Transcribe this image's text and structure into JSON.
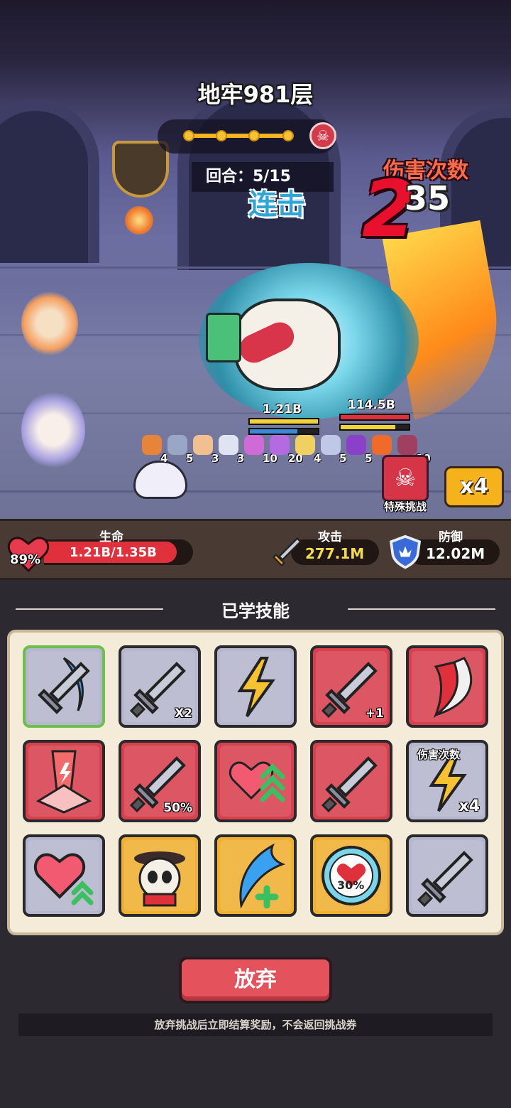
{
  "battle": {
    "title": "地牢981层",
    "round_label": "回合：5/15",
    "damage_count_label": "伤害次数",
    "big_hit": "2",
    "hit_count": "35",
    "combo_label": "连击",
    "enemy_hp_left": "1.21B",
    "enemy_hp_right": "114.5B",
    "progress_stage": 5,
    "progress_total": 5
  },
  "buffs": [
    {
      "icon": "fox-icon",
      "count": "4",
      "color": "#e8843a"
    },
    {
      "icon": "sword-icon",
      "count": "5",
      "color": "#9aa6c6"
    },
    {
      "icon": "cat-icon",
      "count": "3",
      "color": "#f2c090"
    },
    {
      "icon": "ghost-icon",
      "count": "3",
      "color": "#e0e4f2"
    },
    {
      "icon": "mushroom-icon",
      "count": "10",
      "color": "#d06ad6"
    },
    {
      "icon": "crystal-icon",
      "count": "20",
      "color": "#b46ae0"
    },
    {
      "icon": "staff-icon",
      "count": "4",
      "color": "#f0d060"
    },
    {
      "icon": "angel-icon",
      "count": "5",
      "color": "#c0c8e8"
    },
    {
      "icon": "skull-icon",
      "count": "5",
      "color": "#8a40c8"
    },
    {
      "icon": "fire-icon",
      "count": "",
      "color": "#f06a2a"
    },
    {
      "icon": "hourglass-icon",
      "count": "10",
      "color": "#a04060"
    }
  ],
  "special_challenge": {
    "label": "特殊挑战",
    "icon": "skull-icon"
  },
  "speed": {
    "label": "x4"
  },
  "stats": {
    "life_title": "生命",
    "life_value": "1.21B/1.35B",
    "life_pct": "89%",
    "life_fraction": 0.89,
    "attack_title": "攻击",
    "attack_value": "277.1M",
    "defense_title": "防御",
    "defense_value": "12.02M",
    "colors": {
      "life": "#e0303c",
      "attack": "#f4dc4a",
      "stat_bg": "#4a3a34"
    }
  },
  "skills": {
    "heading": "已学技能",
    "tiles": [
      {
        "name": "sword-wave-skill",
        "icon": "sword-wave-icon",
        "bg": "#b6b6cc",
        "tag": "",
        "selected": true
      },
      {
        "name": "double-sword-skill",
        "icon": "sword-icon",
        "bg": "#b6b6cc",
        "tag": "X2"
      },
      {
        "name": "lightning-skill",
        "icon": "lightning-icon",
        "bg": "#b6b6cc",
        "tag": ""
      },
      {
        "name": "sword-plus-skill",
        "icon": "sword-icon",
        "bg": "#d8404e",
        "tag": "+1"
      },
      {
        "name": "red-slash-skill",
        "icon": "slash-icon",
        "bg": "#d8404e",
        "tag": ""
      },
      {
        "name": "power-beam-skill",
        "icon": "beam-icon",
        "bg": "#d8404e",
        "tag": ""
      },
      {
        "name": "sword-heal-skill",
        "icon": "sword-icon",
        "bg": "#d8404e",
        "tag": "50%"
      },
      {
        "name": "hearts-up-skill",
        "icon": "hearts-icon",
        "bg": "#d8404e",
        "tag": ""
      },
      {
        "name": "sword-up-skill",
        "icon": "sword-icon",
        "bg": "#d8404e",
        "tag": ""
      },
      {
        "name": "damage-count-skill",
        "icon": "lightning-icon",
        "bg": "#b6b6cc",
        "tag": "x4",
        "top_tag": "伤害次数"
      },
      {
        "name": "heart-up-skill",
        "icon": "heart-icon",
        "bg": "#b6b6cc",
        "tag": ""
      },
      {
        "name": "panda-skill",
        "icon": "panda-icon",
        "bg": "#f0b030",
        "tag": ""
      },
      {
        "name": "water-wave-skill",
        "icon": "wave-icon",
        "bg": "#f0b030",
        "tag": ""
      },
      {
        "name": "broken-heart-skill",
        "icon": "broken-heart-icon",
        "bg": "#f0b030",
        "tag": "30%"
      },
      {
        "name": "sword-percent-skill",
        "icon": "sword-icon",
        "bg": "#b6b6cc",
        "tag": ""
      }
    ]
  },
  "footer": {
    "giveup_label": "放弃",
    "note": "放弃挑战后立即结算奖励，不会返回挑战券"
  }
}
